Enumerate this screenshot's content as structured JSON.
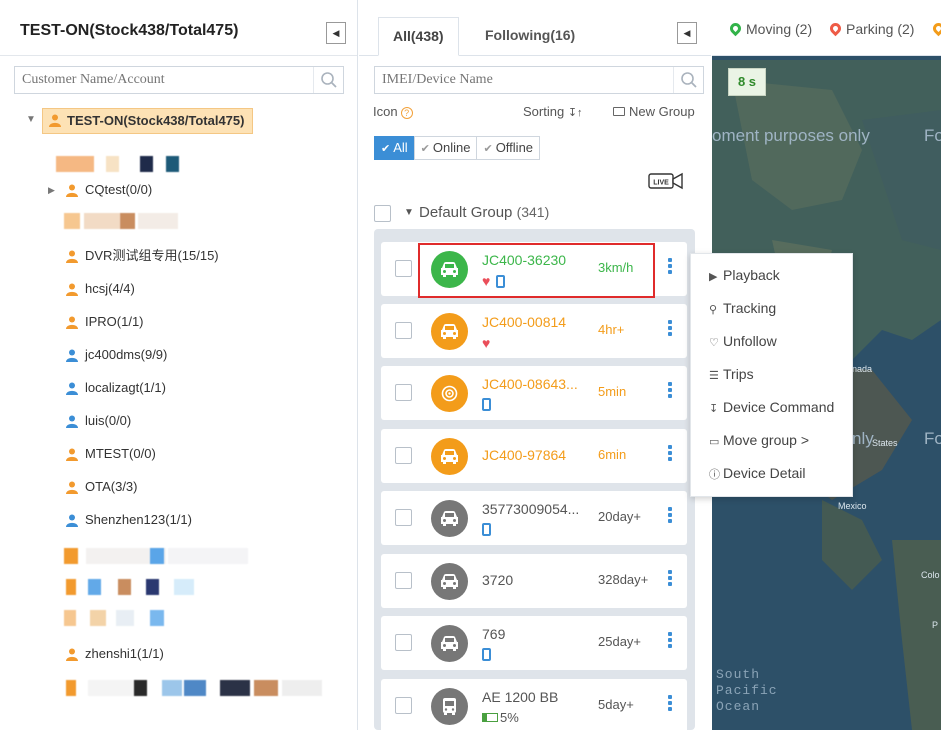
{
  "left_panel": {
    "title": "TEST-ON(Stock438/Total475)",
    "search_placeholder": "Customer Name/Account",
    "root_label": "TEST-ON(Stock438/Total475)",
    "items": [
      {
        "label": "CQtest(0/0)",
        "icon": "orange-user-icon"
      },
      {
        "label": "DVR测试组专用(15/15)",
        "icon": "orange-user-icon"
      },
      {
        "label": "hcsj(4/4)",
        "icon": "orange-user-icon"
      },
      {
        "label": "IPRO(1/1)",
        "icon": "orange-user-icon"
      },
      {
        "label": "jc400dms(9/9)",
        "icon": "blue-user-icon"
      },
      {
        "label": "localizagt(1/1)",
        "icon": "blue-user-icon"
      },
      {
        "label": "luis(0/0)",
        "icon": "blue-user-icon"
      },
      {
        "label": "MTEST(0/0)",
        "icon": "orange-user-icon"
      },
      {
        "label": "OTA(3/3)",
        "icon": "orange-user-icon"
      },
      {
        "label": "Shenzhen123(1/1)",
        "icon": "blue-user-icon"
      },
      {
        "label": "zhenshi1(1/1)",
        "icon": "orange-user-icon"
      }
    ]
  },
  "middle_panel": {
    "tabs": {
      "all": "All(438)",
      "following": "Following(16)"
    },
    "search_placeholder": "IMEI/Device Name",
    "icon_label": "Icon",
    "sorting_label": "Sorting",
    "new_group_label": "New Group",
    "filters": {
      "all": "All",
      "online": "Online",
      "offline": "Offline"
    },
    "live_label": "LIVE",
    "group": {
      "name": "Default Group",
      "count": "(341)"
    },
    "devices": [
      {
        "name": "JC400-36230",
        "status": "3km/h",
        "color": "#3cb64a",
        "name_color": "#3cb64a",
        "status_color": "#3cb64a",
        "icon": "car-icon",
        "sub": [
          "heart",
          "phone"
        ]
      },
      {
        "name": "JC400-00814",
        "status": "4hr+",
        "color": "#f39c1a",
        "name_color": "#f39c1a",
        "status_color": "#f39c1a",
        "icon": "car-icon",
        "sub": [
          "heart"
        ]
      },
      {
        "name": "JC400-08643...",
        "status": "5min",
        "color": "#f39c1a",
        "name_color": "#f39c1a",
        "status_color": "#f39c1a",
        "icon": "target-icon",
        "sub": [
          "phone"
        ]
      },
      {
        "name": "JC400-97864",
        "status": "6min",
        "color": "#f39c1a",
        "name_color": "#f39c1a",
        "status_color": "#f39c1a",
        "icon": "car-icon",
        "sub": []
      },
      {
        "name": "35773009054...",
        "status": "20day+",
        "color": "#777777",
        "name_color": "#555555",
        "status_color": "#555555",
        "icon": "car-icon",
        "sub": [
          "phone"
        ]
      },
      {
        "name": "3720",
        "status": "328day+",
        "color": "#777777",
        "name_color": "#555555",
        "status_color": "#555555",
        "icon": "car-icon",
        "sub": []
      },
      {
        "name": "769",
        "status": "25day+",
        "color": "#777777",
        "name_color": "#555555",
        "status_color": "#555555",
        "icon": "car-icon",
        "sub": [
          "phone"
        ]
      },
      {
        "name": "AE 1200 BB",
        "status": "5day+",
        "color": "#777777",
        "name_color": "#555555",
        "status_color": "#555555",
        "icon": "bus-icon",
        "sub": [
          "battery"
        ],
        "battery": "5%"
      }
    ]
  },
  "map": {
    "legend": {
      "moving": "Moving (2)",
      "parking": "Parking (2)"
    },
    "timer": "8 s",
    "watermark": "oment purposes only",
    "watermark_right": "Fo",
    "watermark_right2": "Fo",
    "labels": {
      "mexico": "Mexico",
      "states": "States",
      "nada": "nada",
      "colo": "Colo",
      "p": "P"
    },
    "ocean": [
      "South",
      "Pacific",
      "Ocean"
    ],
    "faded_text": "nly"
  },
  "context_menu": [
    {
      "label": "Playback",
      "icon": "play-icon"
    },
    {
      "label": "Tracking",
      "icon": "pin-icon"
    },
    {
      "label": "Unfollow",
      "icon": "heart-outline-icon"
    },
    {
      "label": "Trips",
      "icon": "list-icon"
    },
    {
      "label": "Device Command",
      "icon": "command-icon"
    },
    {
      "label": "Move group >",
      "icon": "folder-icon"
    },
    {
      "label": "Device Detail",
      "icon": "info-icon"
    }
  ],
  "colors": {
    "accent": "#3b8ed6",
    "online": "#3cb64a",
    "idle": "#f39c1a",
    "offline": "#777777",
    "highlight": "#e02b2b"
  }
}
